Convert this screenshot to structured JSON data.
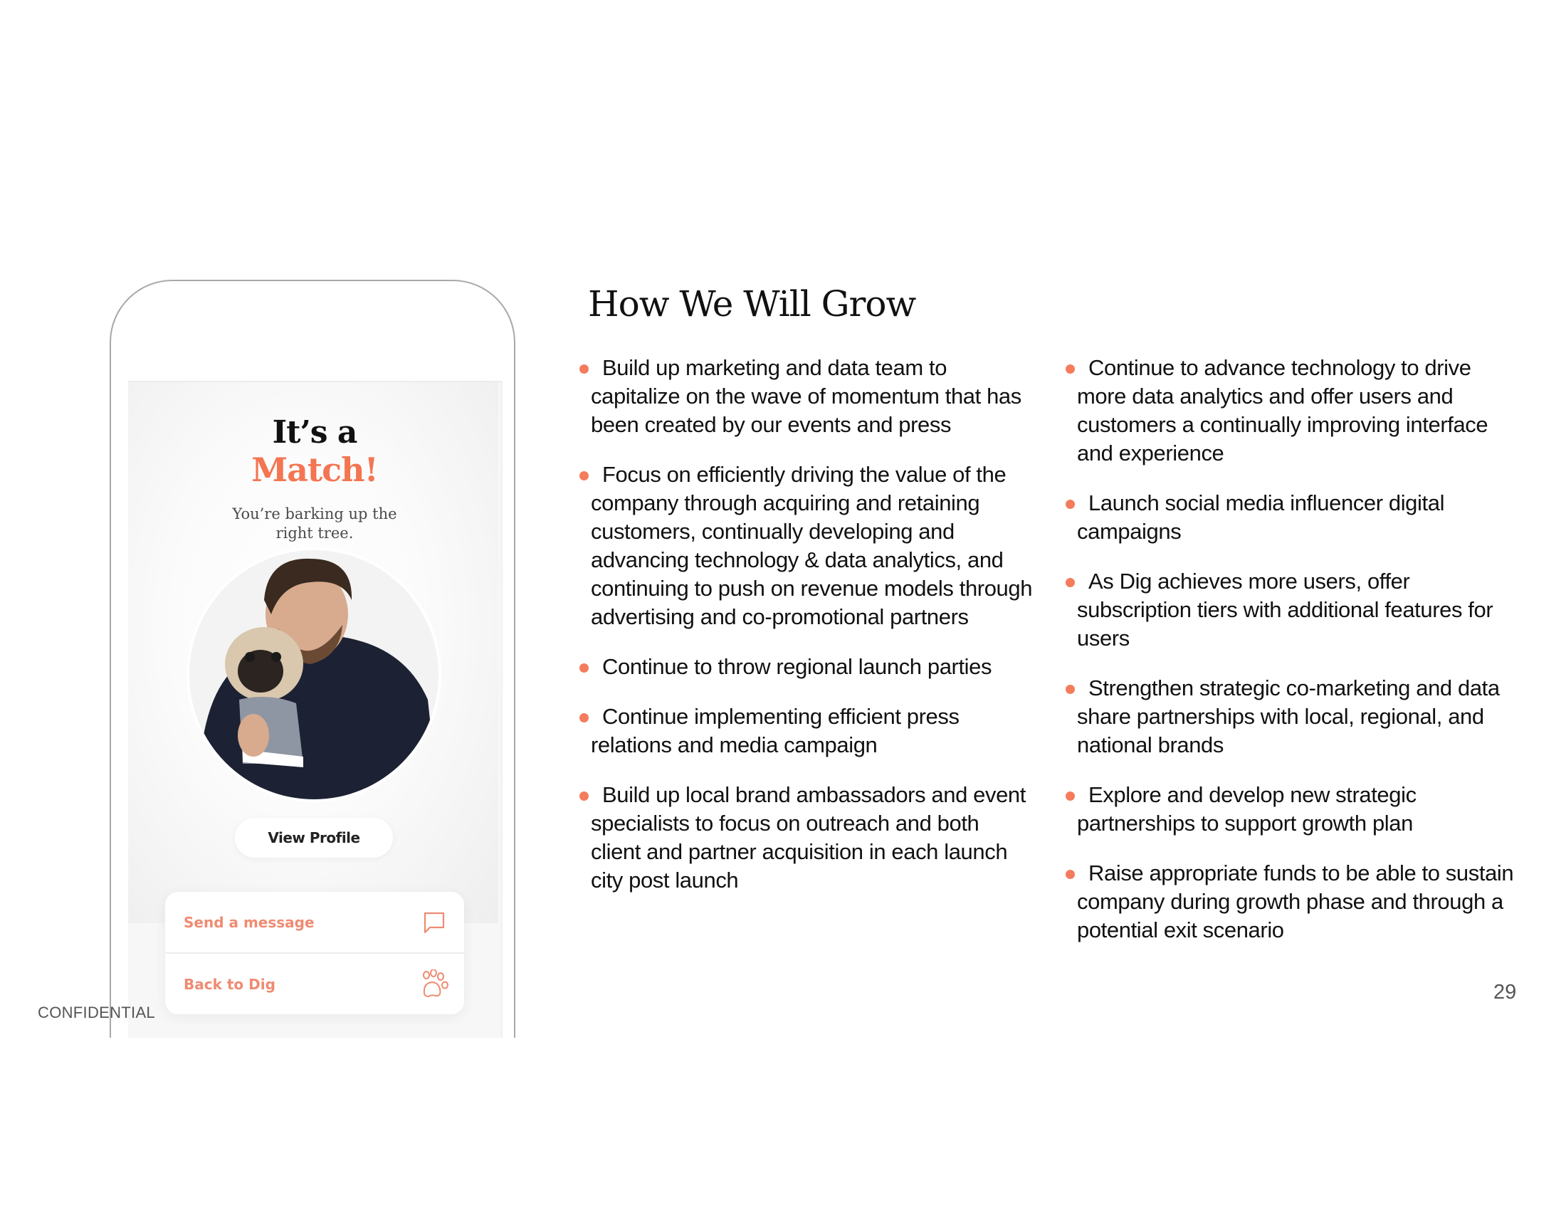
{
  "slide": {
    "title": "How We Will Grow",
    "page_number": "29",
    "footer_label": "CONFIDENTIAL",
    "accent_color": "#f47552"
  },
  "phone": {
    "headline_line1": "It’s a",
    "headline_line2": "Match!",
    "subtitle_line1": "You’re barking up the",
    "subtitle_line2": "right tree.",
    "avatar_icon": "profile-photo-man-with-pug",
    "view_profile_label": "View Profile",
    "actions": [
      {
        "label": "Send a message",
        "icon": "chat-bubble-icon"
      },
      {
        "label": "Back to Dig",
        "icon": "paw-icon"
      }
    ]
  },
  "bullets_left": [
    "Build up marketing and data team to capitalize on the wave of momentum that has been created by our events and press",
    "Focus on efficiently driving the value of the company through acquiring and retaining customers, continually developing and advancing technology & data analytics, and continuing to push on revenue models through advertising and co-promotional partners",
    "Continue to throw regional launch parties",
    "Continue implementing efficient press relations and media campaign",
    "Build up local brand ambassadors and event specialists to focus on outreach and both client and partner acquisition in each launch city post launch"
  ],
  "bullets_right": [
    "Continue to advance technology to drive more data analytics and offer users and customers a continually improving interface and experience",
    "Launch social media influencer digital campaigns",
    "As Dig achieves more users, offer subscription tiers with additional features for users",
    "Strengthen strategic co-marketing and data share partnerships with local, regional, and national brands",
    "Explore and develop new strategic partnerships to support growth plan",
    "Raise appropriate funds to be able to sustain company during growth phase and through a potential exit scenario"
  ]
}
